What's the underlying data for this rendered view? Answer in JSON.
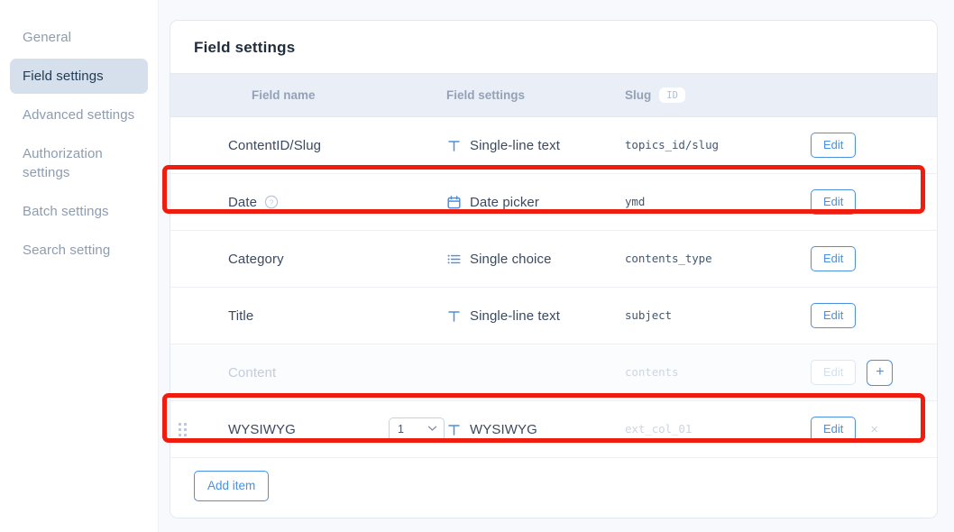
{
  "sidebar": {
    "items": [
      {
        "label": "General",
        "active": false
      },
      {
        "label": "Field settings",
        "active": true
      },
      {
        "label": "Advanced settings",
        "active": false
      },
      {
        "label": "Authorization settings",
        "active": false
      },
      {
        "label": "Batch settings",
        "active": false
      },
      {
        "label": "Search setting",
        "active": false
      }
    ]
  },
  "card": {
    "title": "Field settings",
    "table": {
      "headers": {
        "field_name": "Field name",
        "field_settings": "Field settings",
        "slug": "Slug",
        "slug_badge": "ID"
      },
      "rows": [
        {
          "name": "ContentID/Slug",
          "has_help": false,
          "type": "Single-line text",
          "type_icon": "text-t-icon",
          "slug": "topics_id/slug",
          "edit_label": "Edit",
          "disabled": false,
          "highlighted": false,
          "has_handle": false,
          "has_select": false,
          "has_plus": false,
          "has_close": false
        },
        {
          "name": "Date",
          "has_help": true,
          "type": "Date picker",
          "type_icon": "calendar-icon",
          "slug": "ymd",
          "edit_label": "Edit",
          "disabled": false,
          "highlighted": true,
          "has_handle": false,
          "has_select": false,
          "has_plus": false,
          "has_close": false
        },
        {
          "name": "Category",
          "has_help": false,
          "type": "Single choice",
          "type_icon": "list-icon",
          "slug": "contents_type",
          "edit_label": "Edit",
          "disabled": false,
          "highlighted": false,
          "has_handle": false,
          "has_select": false,
          "has_plus": false,
          "has_close": false
        },
        {
          "name": "Title",
          "has_help": false,
          "type": "Single-line text",
          "type_icon": "text-t-icon",
          "slug": "subject",
          "edit_label": "Edit",
          "disabled": false,
          "highlighted": false,
          "has_handle": false,
          "has_select": false,
          "has_plus": false,
          "has_close": false
        },
        {
          "name": "Content",
          "has_help": false,
          "type": "",
          "type_icon": "",
          "slug": "contents",
          "edit_label": "Edit",
          "plus_label": "+",
          "disabled": true,
          "highlighted": false,
          "has_handle": false,
          "has_select": false,
          "has_plus": true,
          "has_close": false
        },
        {
          "name": "WYSIWYG",
          "has_help": false,
          "type": "WYSIWYG",
          "type_icon": "text-t-icon",
          "slug": "ext_col_01",
          "slug_is_placeholder": true,
          "edit_label": "Edit",
          "close_label": "×",
          "select_value": "1",
          "disabled": false,
          "highlighted": true,
          "has_handle": true,
          "has_select": true,
          "has_plus": false,
          "has_close": true
        }
      ]
    },
    "add_item_label": "Add item"
  },
  "colors": {
    "accent": "#4a90e2",
    "highlight": "#f01c0e",
    "header_bg": "#eaeff7",
    "sidebar_active_bg": "#d5e0ec"
  }
}
